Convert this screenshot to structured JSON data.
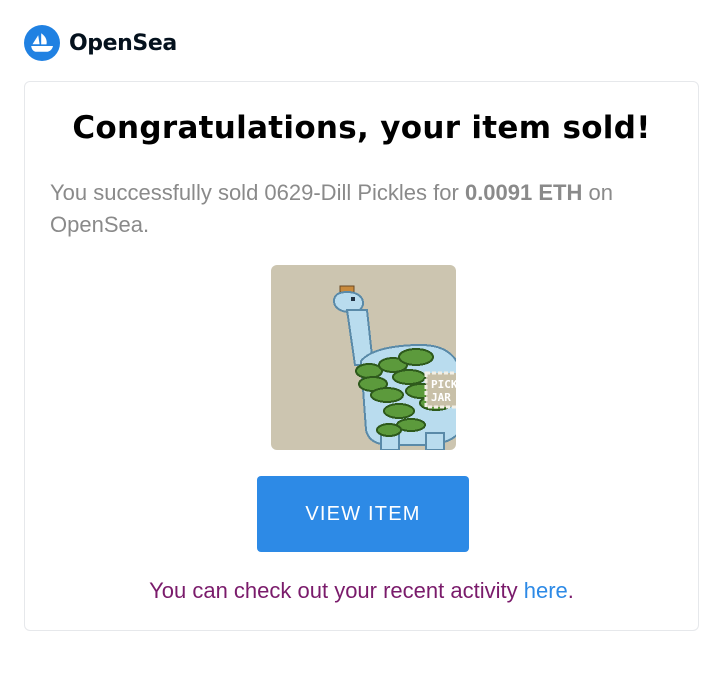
{
  "brand": {
    "name": "OpenSea",
    "logo_icon": "opensea-boat-icon",
    "logo_color": "#2081e2"
  },
  "email": {
    "headline": "Congratulations, your item sold!",
    "message_prefix": "You successfully sold 0629-Dill Pickles for",
    "price": "0.0091 ETH",
    "message_suffix": "on OpenSea.",
    "item_image_label": "pixel-art dinosaur wrapped in pickles",
    "item_image_text": "PICKLE JAR",
    "button_label": "VIEW ITEM",
    "footer_text": "You can check out your recent activity",
    "footer_link": "here",
    "footer_end": "."
  },
  "colors": {
    "button": "#2d8ae6",
    "link": "#2d8ae6",
    "footer_text": "#7a1b6b",
    "body_text": "#8a8a8a",
    "card_border": "#e6e8eb"
  }
}
